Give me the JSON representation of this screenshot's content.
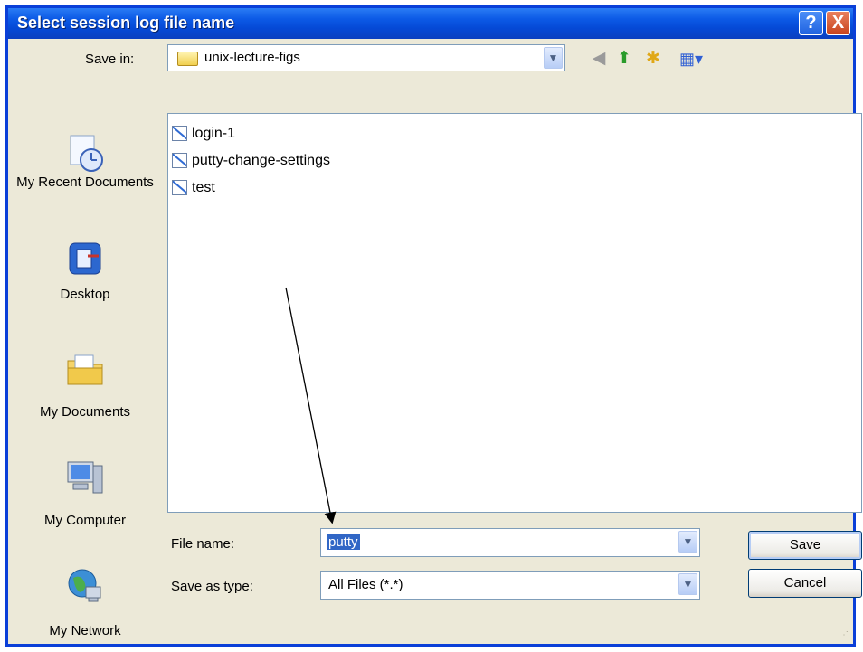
{
  "window": {
    "title": "Select session log file name",
    "help_glyph": "?",
    "close_glyph": "X"
  },
  "save_in": {
    "label": "Save in:",
    "value": "unix-lecture-figs"
  },
  "toolbar": {
    "icons": [
      "back-icon",
      "up-folder-icon",
      "new-folder-icon",
      "views-menu-icon"
    ]
  },
  "places": [
    {
      "label": "My Recent Documents",
      "icon": "recent-documents-icon"
    },
    {
      "label": "Desktop",
      "icon": "desktop-icon"
    },
    {
      "label": "My Documents",
      "icon": "my-documents-icon"
    },
    {
      "label": "My Computer",
      "icon": "my-computer-icon"
    },
    {
      "label": "My Network",
      "icon": "my-network-icon"
    }
  ],
  "files": [
    {
      "name": "login-1"
    },
    {
      "name": "putty-change-settings"
    },
    {
      "name": "test"
    }
  ],
  "file_name": {
    "label": "File name:",
    "value": "putty"
  },
  "save_as_type": {
    "label": "Save as type:",
    "value": "All Files (*.*)"
  },
  "buttons": {
    "save": "Save",
    "cancel": "Cancel"
  },
  "colors": {
    "title_bar": "#0549d6",
    "dialog_face": "#ece9d8",
    "selection": "#3167c6"
  }
}
